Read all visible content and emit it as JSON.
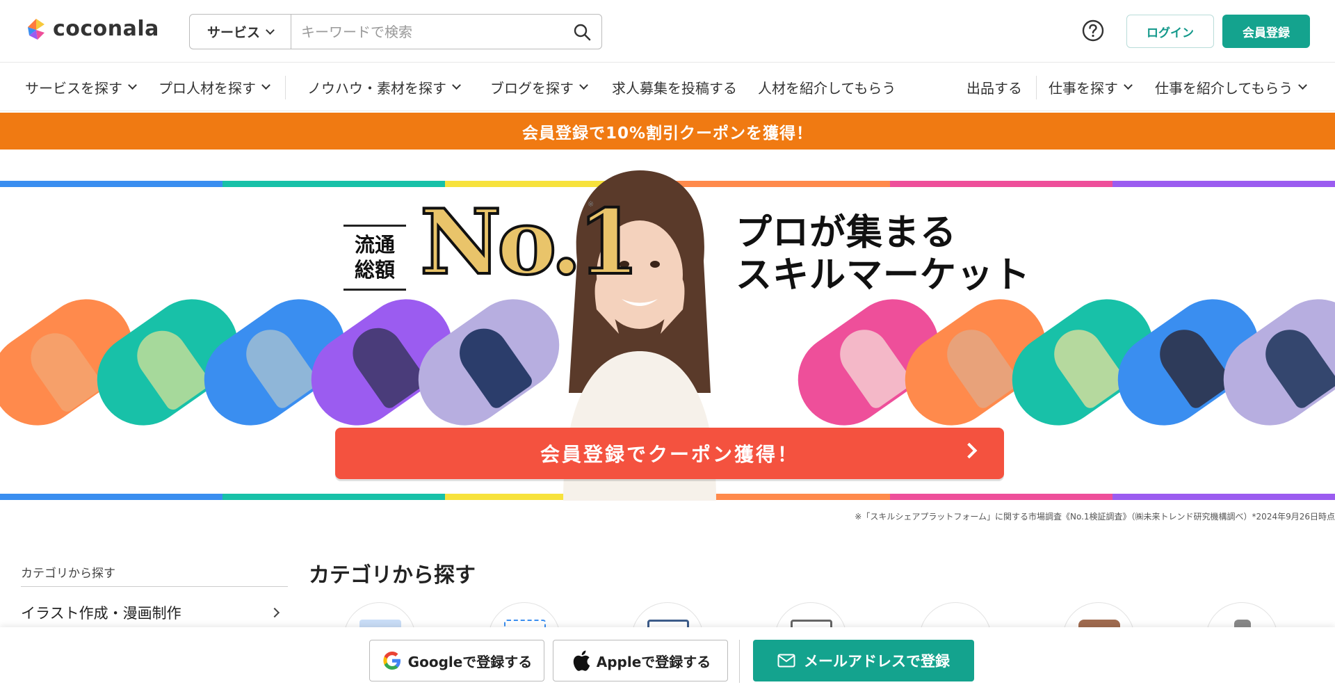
{
  "header": {
    "logo_text": "coconala",
    "search_category": "サービス",
    "search_placeholder": "キーワードで検索",
    "login_label": "ログイン",
    "signup_label": "会員登録"
  },
  "nav": {
    "left_items": [
      {
        "label": "サービスを探す"
      },
      {
        "label": "プロ人材を探す"
      },
      {
        "label": "ノウハウ・素材を探す"
      },
      {
        "label": "ブログを探す"
      },
      {
        "label": "求人募集を投稿する"
      },
      {
        "label": "人材を紹介してもらう"
      }
    ],
    "right_items": [
      {
        "label": "出品する"
      },
      {
        "label": "仕事を探す"
      },
      {
        "label": "仕事を紹介してもらう"
      }
    ]
  },
  "coupon_bar": "会員登録で10%割引クーポンを獲得！",
  "hero": {
    "tag_line1": "流通",
    "tag_line2": "総額",
    "no1": "No.1",
    "note_mark": "※",
    "title_line1": "プロが集まる",
    "title_line2": "スキルマーケット",
    "cta_label": "会員登録でクーポン獲得！",
    "footnote": "※「スキルシェアプラットフォーム」に関する市場調査《No.1検証調査》（㈱未来トレンド研究機構調べ）*2024年9月26日時点"
  },
  "sidebar": {
    "title": "カテゴリから探す",
    "items": [
      {
        "label": "イラスト作成・漫画制作"
      }
    ]
  },
  "main": {
    "title": "カテゴリから探す"
  },
  "bottom_bar": {
    "google_label": "Googleで登録する",
    "apple_label": "Appleで登録する",
    "mail_label": "メールアドレスで登録"
  },
  "colors": {
    "brand": "#14a38e",
    "coupon_bar": "#f07a12",
    "cta": "#f4523f",
    "stripe": [
      "#3a8ef0",
      "#18c1a8",
      "#f7e23c",
      "#ff8a4c",
      "#ee4f9a",
      "#9b5cf0"
    ]
  },
  "icons": {
    "help": "question-circle-icon",
    "search": "magnifier-icon",
    "google": "google-g-icon",
    "apple": "apple-logo-icon",
    "mail": "envelope-icon"
  }
}
